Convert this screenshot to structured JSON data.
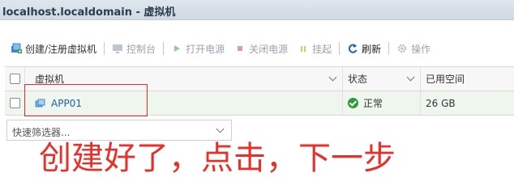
{
  "window": {
    "title": "localhost.localdomain - 虚拟机"
  },
  "toolbar": {
    "items": [
      {
        "label": "创建/注册虚拟机",
        "icon": "create-vm-icon",
        "enabled": true
      },
      {
        "label": "控制台",
        "icon": "console-icon",
        "enabled": false
      },
      {
        "label": "打开电源",
        "icon": "power-on-icon",
        "enabled": false
      },
      {
        "label": "关闭电源",
        "icon": "power-off-icon",
        "enabled": false
      },
      {
        "label": "挂起",
        "icon": "suspend-icon",
        "enabled": false
      },
      {
        "label": "刷新",
        "icon": "refresh-icon",
        "enabled": true
      },
      {
        "label": "操作",
        "icon": "gear-icon",
        "enabled": false
      }
    ]
  },
  "grid": {
    "columns": [
      "虚拟机",
      "状态",
      "已用空间"
    ],
    "rows": [
      {
        "name": "APP01",
        "status": "正常",
        "used": "26 GB"
      }
    ]
  },
  "filter": {
    "placeholder": "快速筛选器..."
  },
  "annotation": {
    "text": "创建好了，点击，下一步"
  },
  "colors": {
    "annotation": "#e8302b",
    "status_ok": "#2e9b3b",
    "link": "#1f5fa6"
  }
}
